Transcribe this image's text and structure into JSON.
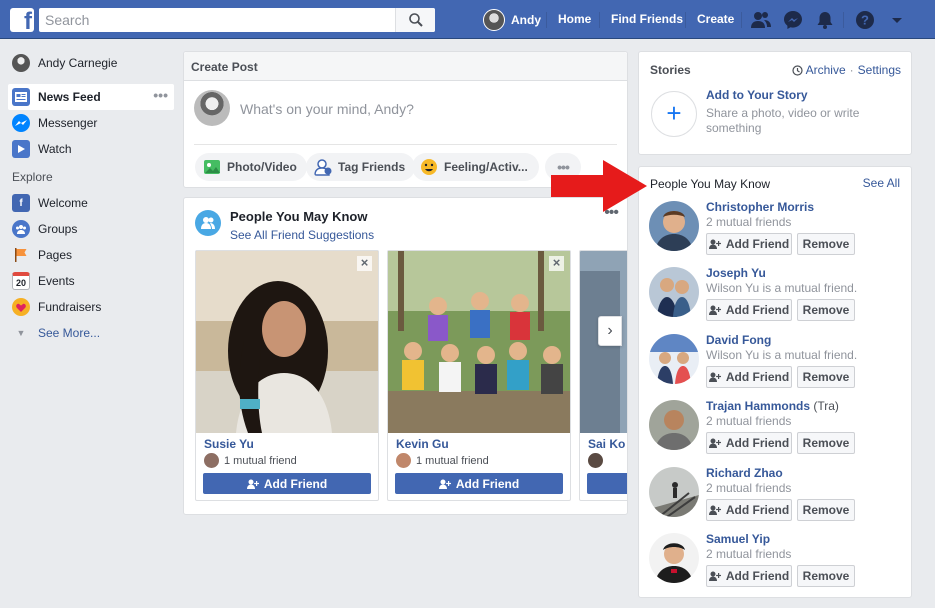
{
  "topbar": {
    "logo": "f",
    "search_placeholder": "Search",
    "user_name": "Andy",
    "home": "Home",
    "find_friends": "Find Friends",
    "create": "Create",
    "brand_color": "#4267b2"
  },
  "left_nav": {
    "profile_name": "Andy Carnegie",
    "items": [
      {
        "label": "News Feed",
        "icon": "news-feed-icon"
      },
      {
        "label": "Messenger",
        "icon": "messenger-icon"
      },
      {
        "label": "Watch",
        "icon": "watch-icon"
      }
    ],
    "explore_heading": "Explore",
    "explore": [
      {
        "label": "Welcome",
        "icon": "facebook-icon"
      },
      {
        "label": "Groups",
        "icon": "groups-icon"
      },
      {
        "label": "Pages",
        "icon": "pages-flag-icon"
      },
      {
        "label": "Events",
        "icon": "calendar-icon",
        "icon_text": "20"
      },
      {
        "label": "Fundraisers",
        "icon": "fundraiser-icon"
      }
    ],
    "see_more": "See More..."
  },
  "create_post": {
    "title": "Create Post",
    "placeholder": "What's on your mind, Andy?",
    "actions": [
      {
        "label": "Photo/Video",
        "icon": "photo-icon"
      },
      {
        "label": "Tag Friends",
        "icon": "tag-friends-icon"
      },
      {
        "label": "Feeling/Activ...",
        "icon": "smiley-icon"
      }
    ]
  },
  "pymk_center": {
    "title": "People You May Know",
    "subtitle": "See All Friend Suggestions",
    "cards": [
      {
        "name": "Susie Yu",
        "mutual": "1 mutual friend",
        "button": "Add Friend"
      },
      {
        "name": "Kevin Gu",
        "mutual": "1 mutual friend",
        "button": "Add Friend"
      },
      {
        "name": "Sai Ko",
        "mutual": "",
        "button": ""
      }
    ]
  },
  "stories": {
    "title": "Stories",
    "archive": "Archive",
    "dot": "·",
    "settings": "Settings",
    "add_title": "Add to Your Story",
    "add_sub": "Share a photo, video or write something"
  },
  "pymk_right": {
    "title": "People You May Know",
    "see_all": "See All",
    "add_label": "Add Friend",
    "remove_label": "Remove",
    "people": [
      {
        "name": "Christopher Morris",
        "extra": "",
        "mutual": "2 mutual friends"
      },
      {
        "name": "Joseph Yu",
        "extra": "",
        "mutual": "Wilson Yu is a mutual friend."
      },
      {
        "name": "David Fong",
        "extra": "",
        "mutual": "Wilson Yu is a mutual friend."
      },
      {
        "name": "Trajan Hammonds",
        "extra": "(Tra)",
        "mutual": "2 mutual friends"
      },
      {
        "name": "Richard Zhao",
        "extra": "",
        "mutual": "2 mutual friends"
      },
      {
        "name": "Samuel Yip",
        "extra": "",
        "mutual": "2 mutual friends"
      }
    ]
  }
}
